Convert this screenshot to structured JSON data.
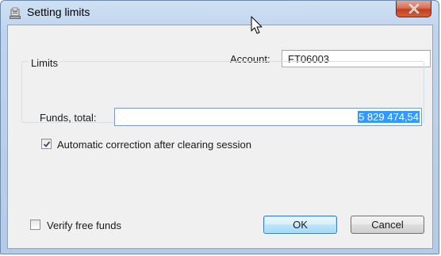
{
  "window": {
    "title": "Setting limits",
    "close_label": "x"
  },
  "account": {
    "label": "Account:",
    "value": "FT06003"
  },
  "limits": {
    "group_label": "Limits",
    "funds_label": "Funds, total:",
    "funds_value": "5 829 474,54",
    "auto_correction_label": "Automatic correction after clearing session",
    "auto_correction_checked": true
  },
  "verify_free_funds": {
    "label": "Verify free funds",
    "checked": false
  },
  "buttons": {
    "ok": "OK",
    "cancel": "Cancel"
  },
  "colors": {
    "selection": "#3399ff",
    "title_bar": "#bed4ee",
    "close_button": "#c1401f",
    "dialog_background": "#f0f0f0"
  }
}
